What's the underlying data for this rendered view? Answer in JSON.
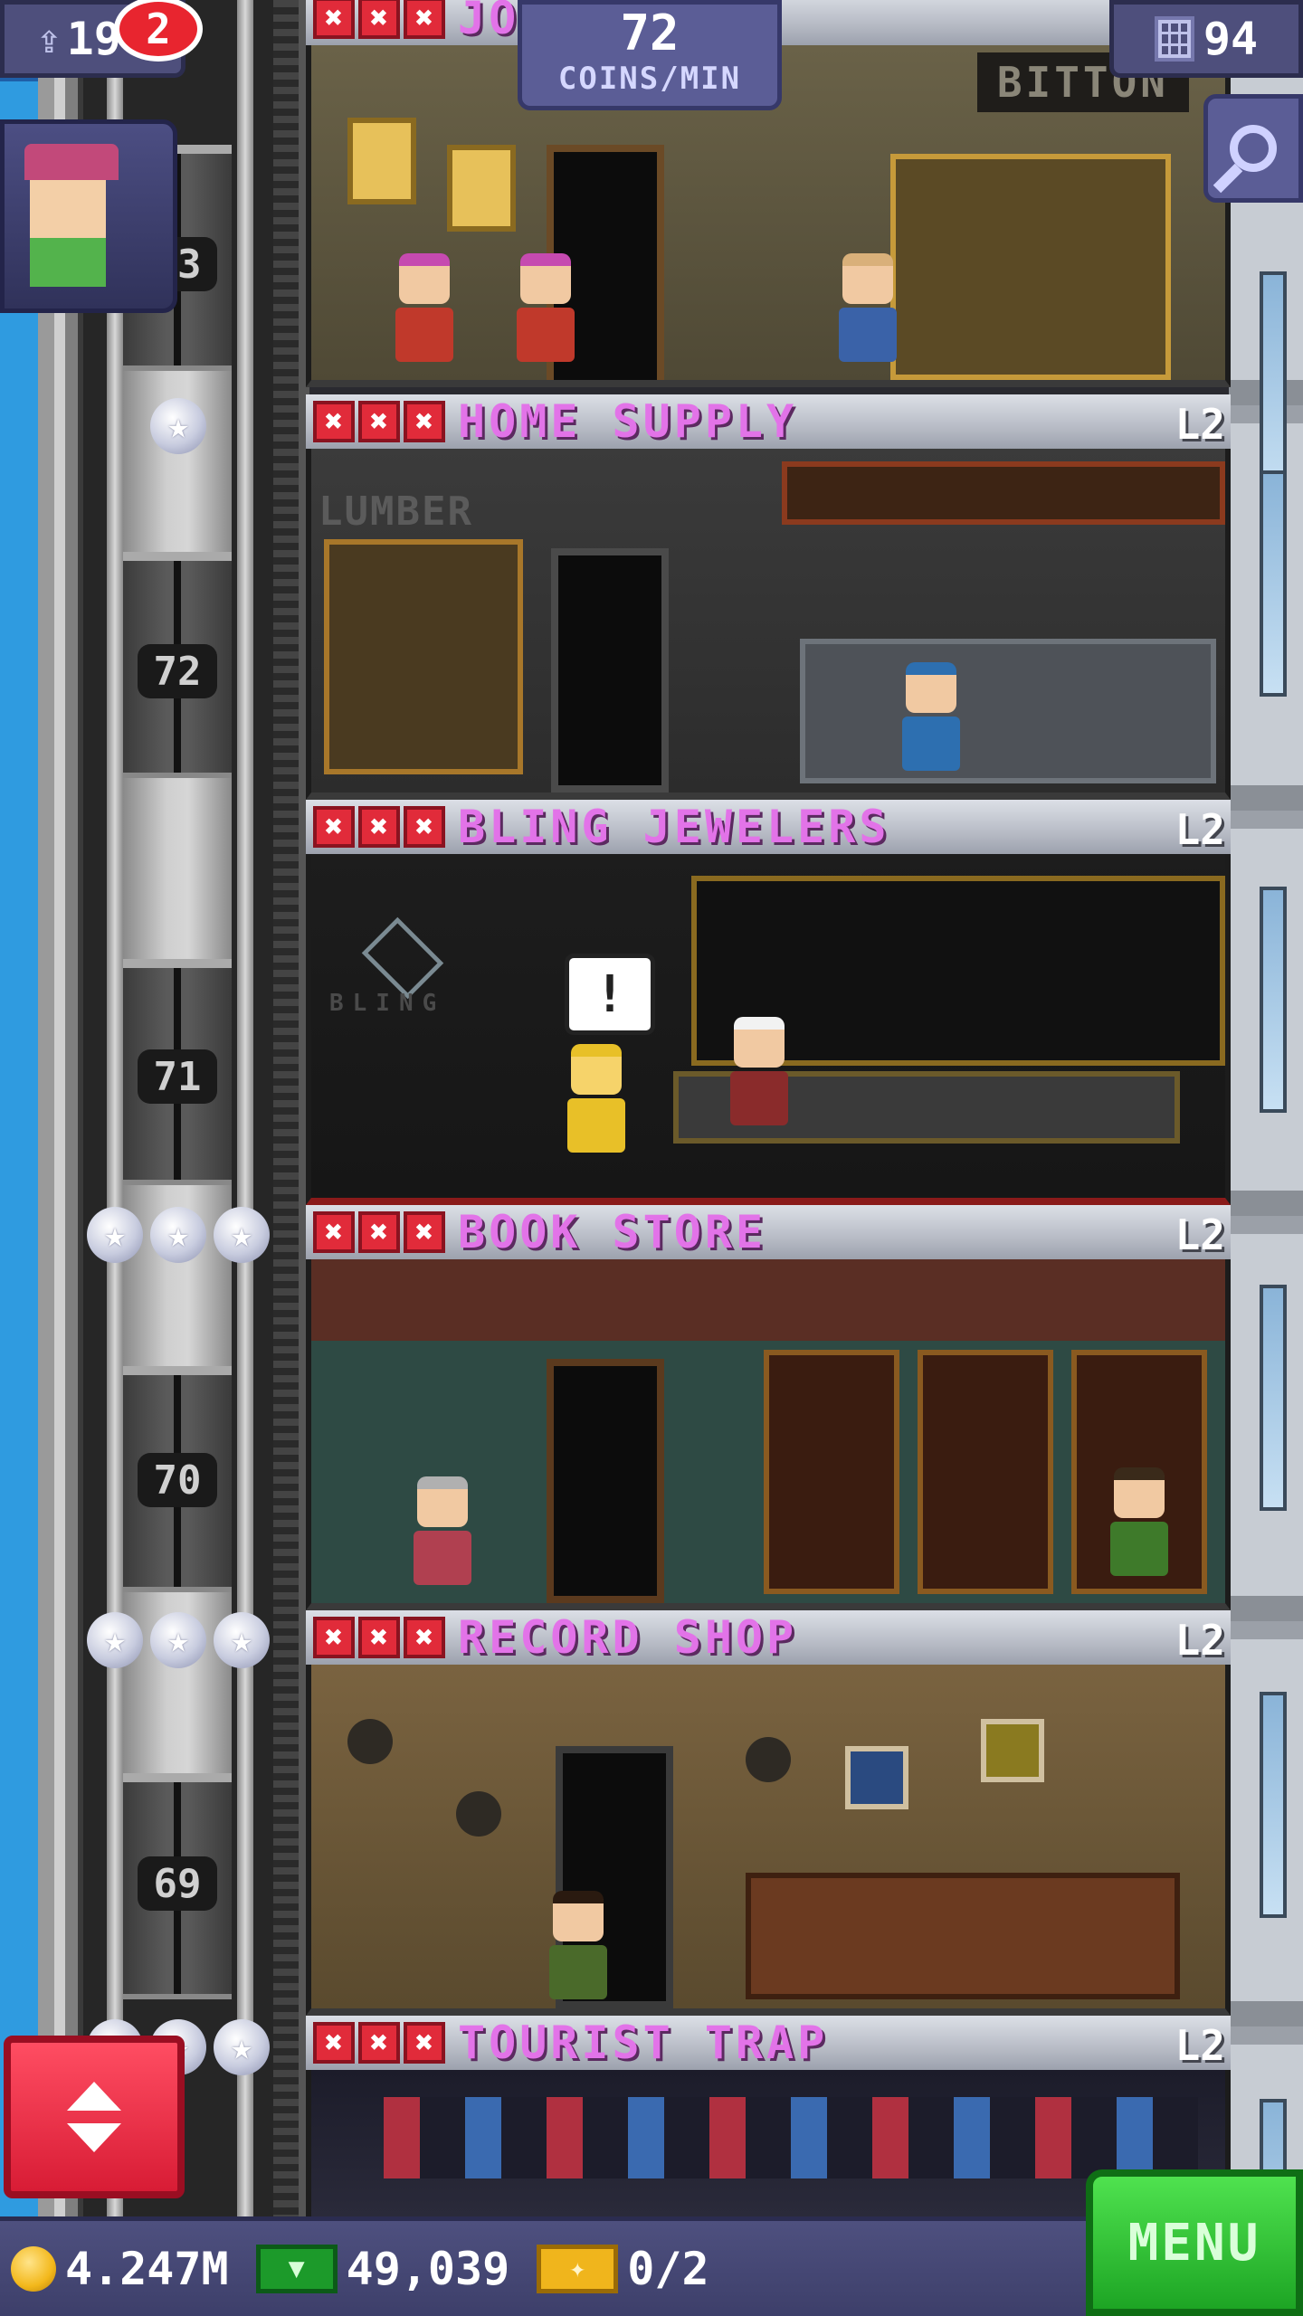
{
  "hud": {
    "population": "194",
    "coins_per_min_value": "72",
    "coins_per_min_label": "COINS/MIN",
    "floor_count": "94"
  },
  "visitor": {
    "notification_count": "2"
  },
  "elevator": {
    "floor_numbers": [
      "73",
      "72",
      "71",
      "70",
      "69"
    ]
  },
  "floors": [
    {
      "name": "JO        N",
      "level": "",
      "xmarks": [
        "✖",
        "✖",
        "✖"
      ],
      "sign": "BITTON"
    },
    {
      "name": "HOME SUPPLY",
      "level": "L2",
      "xmarks": [
        "✖",
        "✖",
        "✖"
      ],
      "sign": "LUMBER"
    },
    {
      "name": "BLING JEWELERS",
      "level": "L2",
      "xmarks": [
        "✖",
        "✖",
        "✖"
      ],
      "sign": "BLING",
      "bubble": "!"
    },
    {
      "name": "BOOK STORE",
      "level": "L2",
      "xmarks": [
        "✖",
        "✖",
        "✖"
      ]
    },
    {
      "name": "RECORD SHOP",
      "level": "L2",
      "xmarks": [
        "✖",
        "✖",
        "✖"
      ]
    },
    {
      "name": "TOURIST TRAP",
      "level": "L2",
      "xmarks": [
        "✖",
        "✖",
        "✖"
      ]
    }
  ],
  "bottom_bar": {
    "coins": "4.247M",
    "bux": "49,039",
    "tickets": "0/2",
    "menu_label": "MENU"
  },
  "colors": {
    "store_name": "#e273e8",
    "xmark": "#e12b3a",
    "menu": "#1da524",
    "elevator_button": "#d81c35",
    "hud": "#4e4f7c"
  },
  "icons": {
    "population": "person-icon",
    "floors": "building-icon",
    "search": "magnifier-icon",
    "coin": "coin-icon",
    "bux": "bux-icon",
    "ticket": "ticket-icon",
    "elevator": "up-down-arrows-icon"
  }
}
